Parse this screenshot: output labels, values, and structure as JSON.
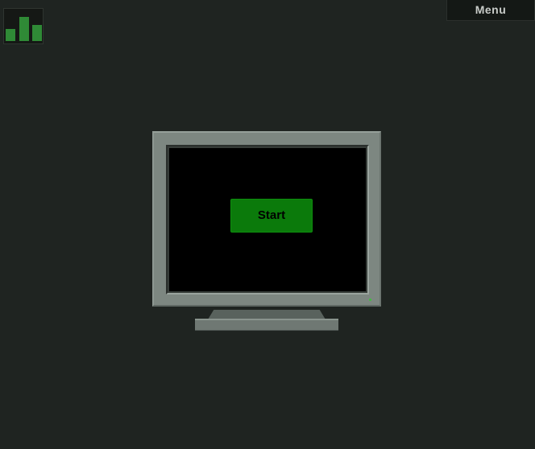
{
  "toolbar": {
    "menu_label": "Menu",
    "stats_icon": "bar-chart-icon",
    "stats_bars": [
      0.42,
      0.83,
      0.55
    ]
  },
  "monitor": {
    "start_label": "Start",
    "colors": {
      "background": "#1f2421",
      "monitor_frame": "#7d8781",
      "screen": "#000000",
      "start_button": "#0b7a0b",
      "bar": "#2f8a36",
      "power_led": "#3fbf3f"
    }
  }
}
